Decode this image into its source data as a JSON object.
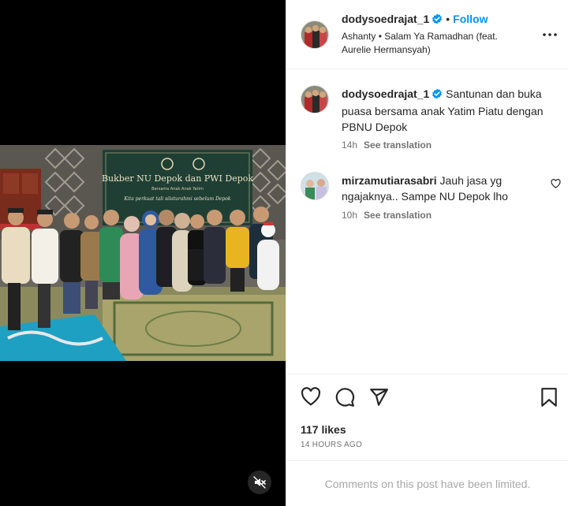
{
  "post": {
    "username": "dodysoedrajat_1",
    "follow_label": "Follow",
    "separator": "•",
    "audio": "Ashanty • Salam Ya Ramadhan (feat. Aurelie Hermansyah)"
  },
  "banner": {
    "title": "Bukber NU Depok dan PWI Depok",
    "subtitle": "Bersama Anak Anak Yatim",
    "quote": "Kita perkuat tali silaturahmi sebelum Depok"
  },
  "caption": {
    "username": "dodysoedrajat_1",
    "text": "Santunan dan buka puasa bersama anak Yatim Piatu dengan PBNU Depok",
    "time": "14h",
    "see_translation": "See translation"
  },
  "comments": [
    {
      "username": "mirzamutiarasabri",
      "text": "Jauh jasa yg ngajaknya.. Sampe NU Depok lho",
      "time": "10h",
      "see_translation": "See translation"
    }
  ],
  "actions": {
    "like_icon": "heart-icon",
    "comment_icon": "comment-icon",
    "share_icon": "send-icon",
    "save_icon": "bookmark-icon"
  },
  "likes": "117 likes",
  "timestamp": "14 HOURS AGO",
  "limited_notice": "Comments on this post have been limited.",
  "colors": {
    "accent": "#0095f6",
    "verified": "#0095f6",
    "text": "#262626",
    "muted": "#737373"
  }
}
